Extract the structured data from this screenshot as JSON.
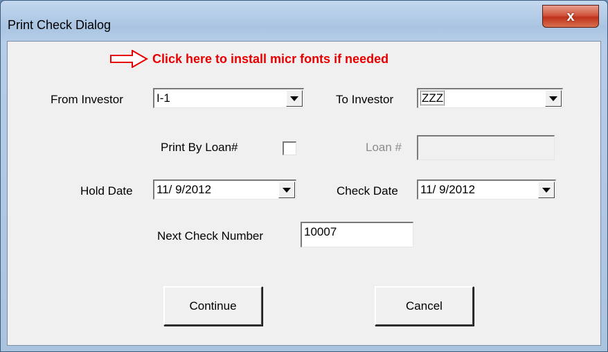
{
  "window": {
    "title": "Print Check Dialog",
    "close_glyph": "x"
  },
  "micr_link": {
    "text": "Click here to install micr fonts if needed",
    "icon": "arrow-right-outline-icon",
    "color": "#e80000"
  },
  "fields": {
    "from_investor": {
      "label": "From Investor",
      "value": "I-1"
    },
    "to_investor": {
      "label": "To Investor",
      "value": "ZZZ"
    },
    "print_by_loan": {
      "label": "Print By Loan#",
      "checked": false
    },
    "loan_number": {
      "label": "Loan #",
      "value": ""
    },
    "hold_date": {
      "label": "Hold Date",
      "value": "11/ 9/2012"
    },
    "check_date": {
      "label": "Check Date",
      "value": "11/ 9/2012"
    },
    "next_check_number": {
      "label": "Next Check Number",
      "value": "10007"
    }
  },
  "buttons": {
    "continue": "Continue",
    "cancel": "Cancel"
  }
}
